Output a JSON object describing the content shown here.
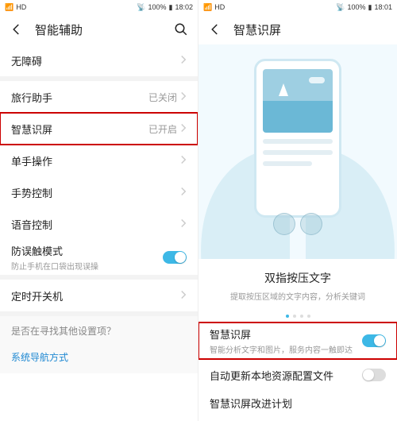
{
  "statusbar": {
    "left": {
      "time": "18:02",
      "time2": "18:01"
    },
    "battery": "100%"
  },
  "left_screen": {
    "title": "智能辅助",
    "rows": {
      "accessibility": "无障碍",
      "travel": {
        "label": "旅行助手",
        "value": "已关闭"
      },
      "hitouch": {
        "label": "智慧识屏",
        "value": "已开启"
      },
      "onehand": "单手操作",
      "gesture": "手势控制",
      "voice": "语音控制",
      "mistouch": {
        "label": "防误触模式",
        "sub": "防止手机在口袋出现误操"
      },
      "schedule": "定时开关机"
    },
    "question": "是否在寻找其他设置项？",
    "link": "系统导航方式"
  },
  "right_screen": {
    "title": "智慧识屏",
    "promo_title": "双指按压文字",
    "promo_desc": "提取按压区域的文字内容，分析关键词",
    "rows": {
      "hitouch": {
        "label": "智慧识屏",
        "sub": "智能分析文字和图片，服务内容一触即达"
      },
      "autoupdate": "自动更新本地资源配置文件",
      "improve_label": "智慧识屏改进计划"
    }
  }
}
